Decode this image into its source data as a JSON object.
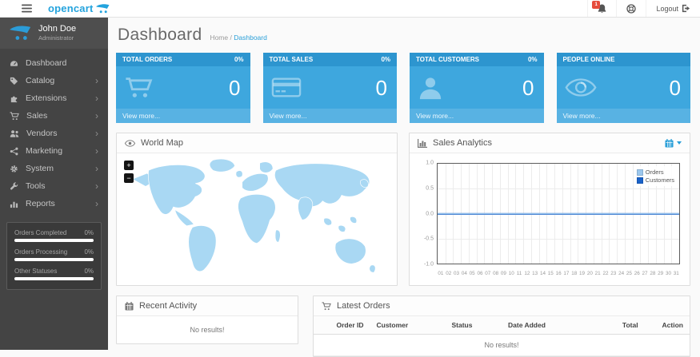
{
  "header": {
    "logo_text": "opencart",
    "notification_count": "1",
    "logout_label": "Logout"
  },
  "sidebar": {
    "user": {
      "name": "John Doe",
      "role": "Administrator"
    },
    "items": [
      {
        "label": "Dashboard",
        "icon": "dashboard-icon",
        "has_submenu": false
      },
      {
        "label": "Catalog",
        "icon": "tag-icon",
        "has_submenu": true
      },
      {
        "label": "Extensions",
        "icon": "puzzle-icon",
        "has_submenu": true
      },
      {
        "label": "Sales",
        "icon": "cart-icon",
        "has_submenu": true
      },
      {
        "label": "Vendors",
        "icon": "users-icon",
        "has_submenu": true
      },
      {
        "label": "Marketing",
        "icon": "share-icon",
        "has_submenu": true
      },
      {
        "label": "System",
        "icon": "gear-icon",
        "has_submenu": true
      },
      {
        "label": "Tools",
        "icon": "wrench-icon",
        "has_submenu": true
      },
      {
        "label": "Reports",
        "icon": "bar-chart-icon",
        "has_submenu": true
      }
    ],
    "chevron": "›",
    "stats": [
      {
        "label": "Orders Completed",
        "value": "0%"
      },
      {
        "label": "Orders Processing",
        "value": "0%"
      },
      {
        "label": "Other Statuses",
        "value": "0%"
      }
    ]
  },
  "page": {
    "title": "Dashboard",
    "breadcrumb": {
      "home": "Home",
      "separator": "/",
      "current": "Dashboard"
    }
  },
  "tiles": [
    {
      "title": "TOTAL ORDERS",
      "percent": "0%",
      "value": "0",
      "link": "View more...",
      "icon": "cart-icon"
    },
    {
      "title": "TOTAL SALES",
      "percent": "0%",
      "value": "0",
      "link": "View more...",
      "icon": "credit-card-icon"
    },
    {
      "title": "TOTAL CUSTOMERS",
      "percent": "0%",
      "value": "0",
      "link": "View more...",
      "icon": "user-icon"
    },
    {
      "title": "PEOPLE ONLINE",
      "percent": "",
      "value": "0",
      "link": "View more...",
      "icon": "eye-icon"
    }
  ],
  "world_map": {
    "title": "World Map",
    "icon": "eye-icon",
    "zoom_in_label": "+",
    "zoom_out_label": "−"
  },
  "sales_analytics": {
    "title": "Sales Analytics",
    "icon": "bar-chart-icon",
    "range_button_icon": "calendar-icon",
    "chart_data": {
      "type": "line",
      "title": "Sales Analytics",
      "x": [
        "01",
        "02",
        "03",
        "04",
        "05",
        "06",
        "07",
        "08",
        "09",
        "10",
        "11",
        "12",
        "13",
        "14",
        "15",
        "16",
        "17",
        "18",
        "19",
        "20",
        "21",
        "22",
        "23",
        "24",
        "25",
        "26",
        "27",
        "28",
        "29",
        "30",
        "31"
      ],
      "series": [
        {
          "name": "Orders",
          "color": "#9cc8ee",
          "values": [
            0,
            0,
            0,
            0,
            0,
            0,
            0,
            0,
            0,
            0,
            0,
            0,
            0,
            0,
            0,
            0,
            0,
            0,
            0,
            0,
            0,
            0,
            0,
            0,
            0,
            0,
            0,
            0,
            0,
            0,
            0
          ]
        },
        {
          "name": "Customers",
          "color": "#1a62c9",
          "values": [
            0,
            0,
            0,
            0,
            0,
            0,
            0,
            0,
            0,
            0,
            0,
            0,
            0,
            0,
            0,
            0,
            0,
            0,
            0,
            0,
            0,
            0,
            0,
            0,
            0,
            0,
            0,
            0,
            0,
            0,
            0
          ]
        }
      ],
      "ylim": [
        -1.0,
        1.0
      ],
      "y_ticks": [
        "1.0",
        "0.5",
        "0.0",
        "-0.5",
        "-1.0"
      ],
      "grid": true,
      "legend_position": "top-right"
    }
  },
  "recent_activity": {
    "title": "Recent Activity",
    "icon": "calendar-icon",
    "empty": "No results!"
  },
  "latest_orders": {
    "title": "Latest Orders",
    "icon": "cart-icon",
    "columns": [
      "Order ID",
      "Customer",
      "Status",
      "Date Added",
      "Total",
      "Action"
    ],
    "empty": "No results!"
  },
  "colors": {
    "accent": "#23a3dd",
    "tile_header": "#2d95cf",
    "tile_body": "#3ea7de",
    "tile_footer": "#58b2e3",
    "map_fill": "#a9d8f3",
    "sidebar_bg": "#444444",
    "badge_red": "#e64c3c"
  }
}
